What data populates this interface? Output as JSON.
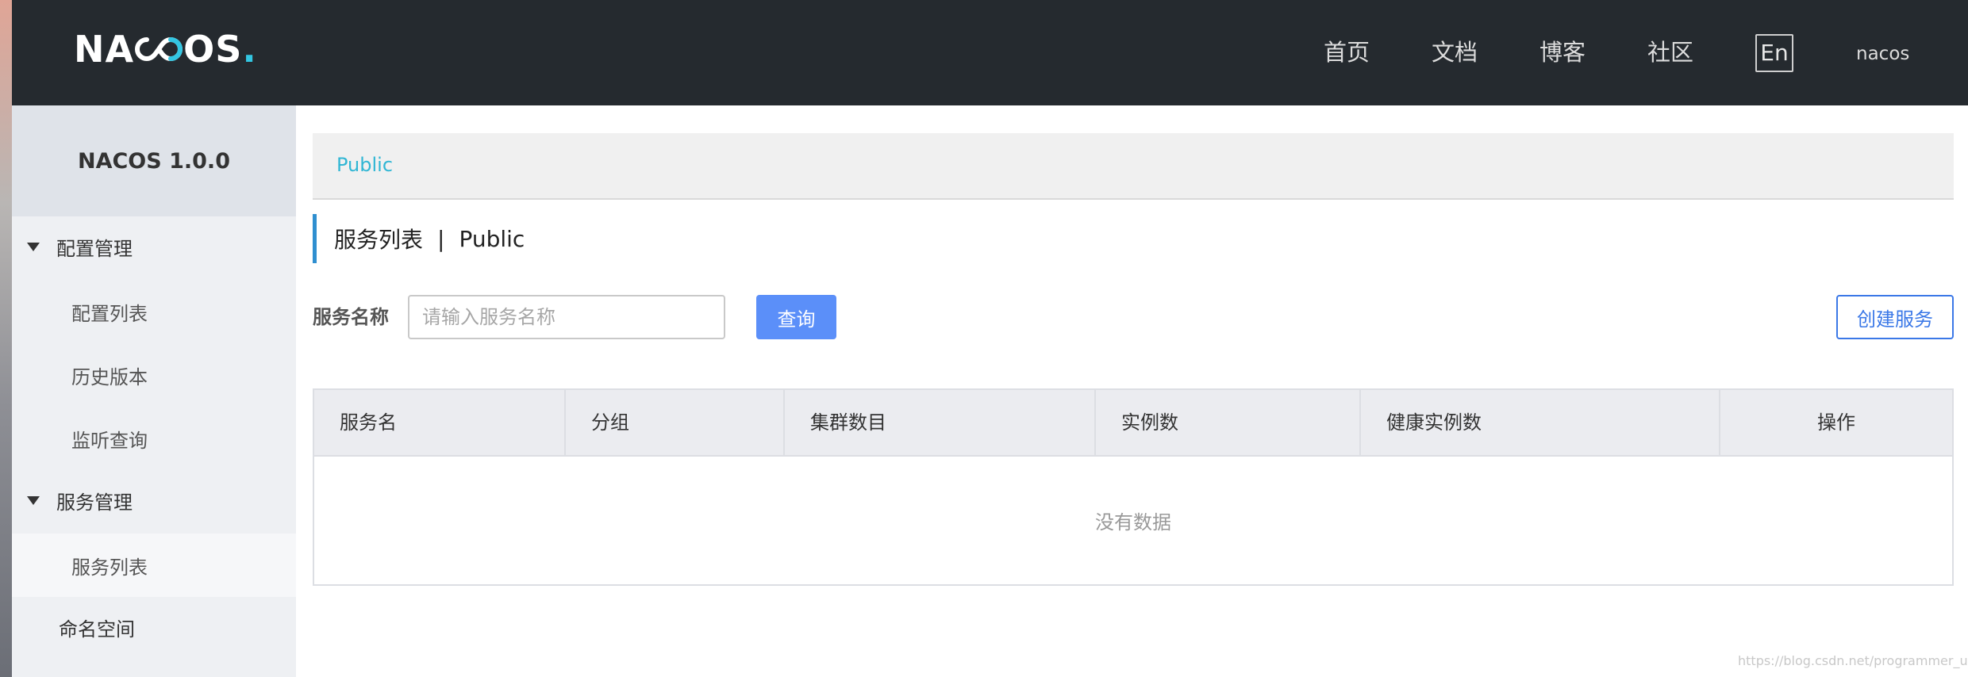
{
  "header": {
    "logo_text_a": "NA",
    "logo_text_b": "OS",
    "logo_dot": ".",
    "nav": [
      "首页",
      "文档",
      "博客",
      "社区"
    ],
    "lang": "En",
    "user": "nacos",
    "colors": {
      "bg": "#252a2f",
      "logo_accent": "#33c6e2"
    }
  },
  "sidebar": {
    "title": "NACOS 1.0.0",
    "groups": [
      {
        "label": "配置管理",
        "items": [
          "配置列表",
          "历史版本",
          "监听查询"
        ]
      },
      {
        "label": "服务管理",
        "items": [
          "服务列表"
        ],
        "active_item": "服务列表"
      }
    ],
    "namespace": "命名空间"
  },
  "main": {
    "namespace_tab": "Public",
    "title": "服务列表",
    "title_sep": "|",
    "title_ns": "Public",
    "filter": {
      "label": "服务名称",
      "placeholder": "请输入服务名称",
      "value": ""
    },
    "query_button": "查询",
    "create_button": "创建服务",
    "table": {
      "columns": [
        "服务名",
        "分组",
        "集群数目",
        "实例数",
        "健康实例数",
        "操作"
      ],
      "rows": [],
      "empty_text": "没有数据"
    },
    "colors": {
      "primary": "#5b8ff9",
      "create_border": "#3b78e7",
      "accent_bar": "#2f8fd0",
      "link": "#30b6d4"
    }
  },
  "watermark": "https://blog.csdn.net/programmer_union"
}
